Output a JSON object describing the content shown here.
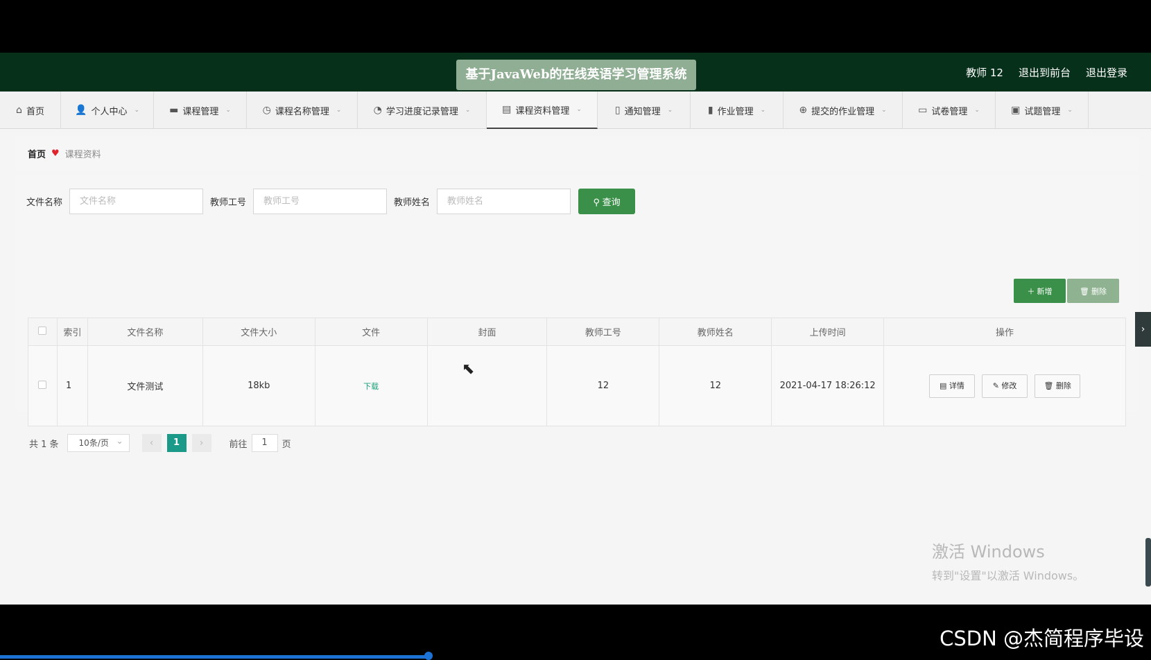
{
  "header": {
    "site_title": "基于JavaWeb的在线英语学习管理系统",
    "user_label": "教师 12",
    "to_front": "退出到前台",
    "logout": "退出登录"
  },
  "nav": [
    {
      "label": "首页",
      "icon": "home-icon",
      "glyph": "⌂",
      "chevron": false
    },
    {
      "label": "个人中心",
      "icon": "user-icon",
      "glyph": "👤",
      "chevron": true
    },
    {
      "label": "课程管理",
      "icon": "book-icon",
      "glyph": "▬",
      "chevron": true
    },
    {
      "label": "课程名称管理",
      "icon": "clock-icon",
      "glyph": "◷",
      "chevron": true
    },
    {
      "label": "学习进度记录管理",
      "icon": "compass-icon",
      "glyph": "◔",
      "chevron": true
    },
    {
      "label": "课程资料管理",
      "icon": "briefcase-icon",
      "glyph": "▤",
      "chevron": true,
      "active": true
    },
    {
      "label": "通知管理",
      "icon": "mic-icon",
      "glyph": "▯",
      "chevron": true
    },
    {
      "label": "作业管理",
      "icon": "bar-chart-icon",
      "glyph": "▮",
      "chevron": true
    },
    {
      "label": "提交的作业管理",
      "icon": "globe-icon",
      "glyph": "⊕",
      "chevron": true
    },
    {
      "label": "试卷管理",
      "icon": "chat-icon",
      "glyph": "▭",
      "chevron": true
    },
    {
      "label": "试题管理",
      "icon": "clipboard-icon",
      "glyph": "▣",
      "chevron": true
    }
  ],
  "breadcrumb": {
    "home": "首页",
    "current": "课程资料"
  },
  "search": {
    "file_name_label": "文件名称",
    "file_name_placeholder": "文件名称",
    "teacher_no_label": "教师工号",
    "teacher_no_placeholder": "教师工号",
    "teacher_name_label": "教师姓名",
    "teacher_name_placeholder": "教师姓名",
    "query_button": "查询"
  },
  "actions": {
    "add": "新增",
    "delete": "删除"
  },
  "table": {
    "headers": [
      "索引",
      "文件名称",
      "文件大小",
      "文件",
      "封面",
      "教师工号",
      "教师姓名",
      "上传时间",
      "操作"
    ],
    "rows": [
      {
        "index": "1",
        "file_name": "文件测试",
        "file_size": "18kb",
        "file_link": "下载",
        "cover": "",
        "teacher_no": "12",
        "teacher_name": "12",
        "upload_time": "2021-04-17 18:26:12"
      }
    ],
    "row_buttons": {
      "detail": "详情",
      "edit": "修改",
      "delete": "删除"
    }
  },
  "pagination": {
    "total": "共 1 条",
    "page_size": "10条/页",
    "current_page": "1",
    "goto_label": "前往",
    "goto_value": "1",
    "page_suffix": "页"
  },
  "watermark": {
    "line1": "激活 Windows",
    "line2": "转到\"设置\"以激活 Windows。"
  },
  "csdn": "CSDN @杰简程序毕设",
  "colors": {
    "header_bg": "#06301a",
    "accent_green": "#3a9048",
    "page_active": "#1b9a8a"
  }
}
